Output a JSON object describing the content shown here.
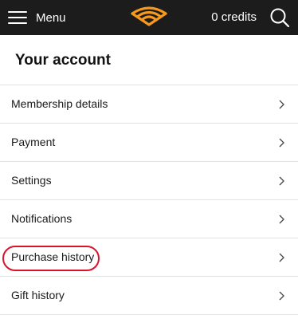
{
  "topbar": {
    "menu_label": "Menu",
    "menu_icon": "hamburger-menu-icon",
    "logo_icon": "audible-logo-icon",
    "credits": "0 credits",
    "search_icon": "search-icon",
    "background_color": "#1c1c1c",
    "brand_color": "#f7991c"
  },
  "page": {
    "title": "Your account"
  },
  "menu_items": [
    {
      "label": "Membership details",
      "icon": "chevron-right-icon"
    },
    {
      "label": "Payment",
      "icon": "chevron-right-icon"
    },
    {
      "label": "Settings",
      "icon": "chevron-right-icon"
    },
    {
      "label": "Notifications",
      "icon": "chevron-right-icon"
    },
    {
      "label": "Purchase history",
      "icon": "chevron-right-icon",
      "highlighted": true
    },
    {
      "label": "Gift history",
      "icon": "chevron-right-icon"
    }
  ],
  "annotation": {
    "highlight_color": "#d8132a"
  }
}
